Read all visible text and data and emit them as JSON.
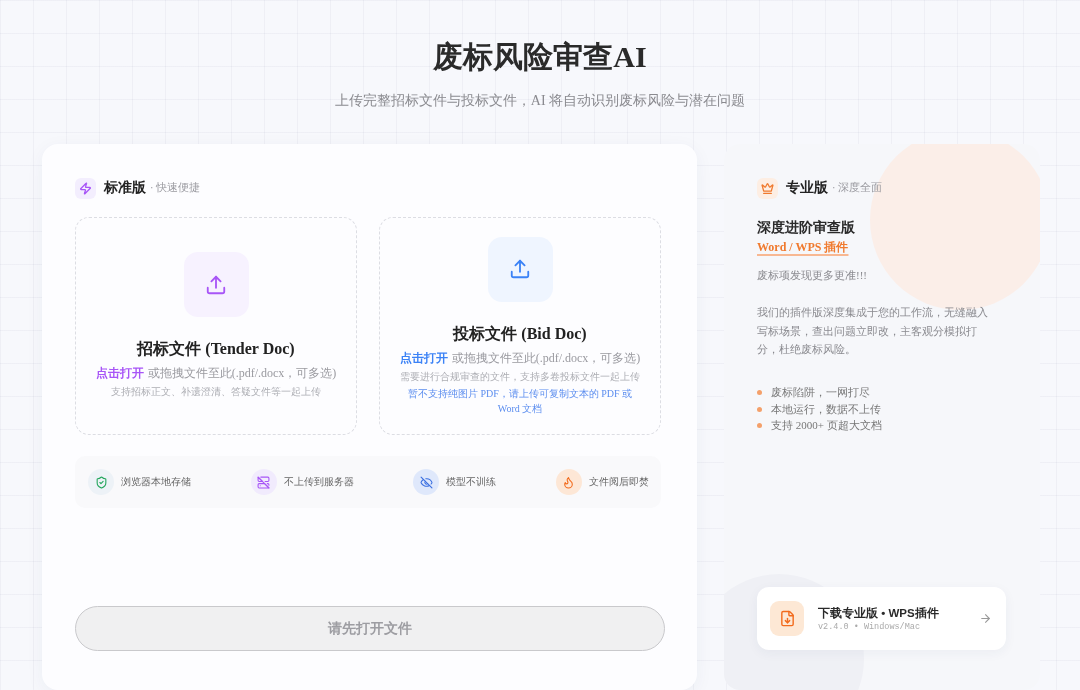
{
  "header": {
    "title": "废标风险审查AI",
    "subtitle": "上传完整招标文件与投标文件，AI 将自动识别废标风险与潜在问题"
  },
  "standard_panel": {
    "title": "标准版",
    "tagline": "· 快速便捷",
    "upload_zones": [
      {
        "kind": "tender",
        "title": "招标文件 (Tender Doc)",
        "action": "点击打开",
        "instruction": "或拖拽文件至此(.pdf/.docx，可多选)",
        "hint": "支持招标正文、补遗澄清、答疑文件等一起上传"
      },
      {
        "kind": "bid",
        "title": "投标文件 (Bid Doc)",
        "action": "点击打开",
        "instruction": "或拖拽文件至此(.pdf/.docx，可多选)",
        "hint": "需要进行合规审查的文件，支持多卷投标文件一起上传",
        "notice": "暂不支持纯图片 PDF，请上传可复制文本的 PDF 或 Word 文档"
      }
    ],
    "features": [
      {
        "kind": "shield",
        "label": "浏览器本地存储"
      },
      {
        "kind": "server-off",
        "label": "不上传到服务器"
      },
      {
        "kind": "eye-off",
        "label": "模型不训练"
      },
      {
        "kind": "flame",
        "label": "文件阅后即焚"
      }
    ],
    "button": {
      "label": "请先打开文件",
      "disabled": true
    }
  },
  "pro_panel": {
    "title": "专业版",
    "tagline": "· 深度全面",
    "heading": "深度进阶审查版",
    "badge": "Word / WPS 插件",
    "highlight": "废标项发现更多更准!!!",
    "description": "我们的插件版深度集成于您的工作流，无缝融入写标场景，查出问题立即改，主客观分模拟打分，杜绝废标风险。",
    "bullets": [
      "废标陷阱，一网打尽",
      "本地运行，数据不上传",
      "支持 2000+ 页超大文档"
    ],
    "download": {
      "title": "下载专业版 • WPS插件",
      "version": "v2.4.0 • Windows/Mac"
    }
  }
}
